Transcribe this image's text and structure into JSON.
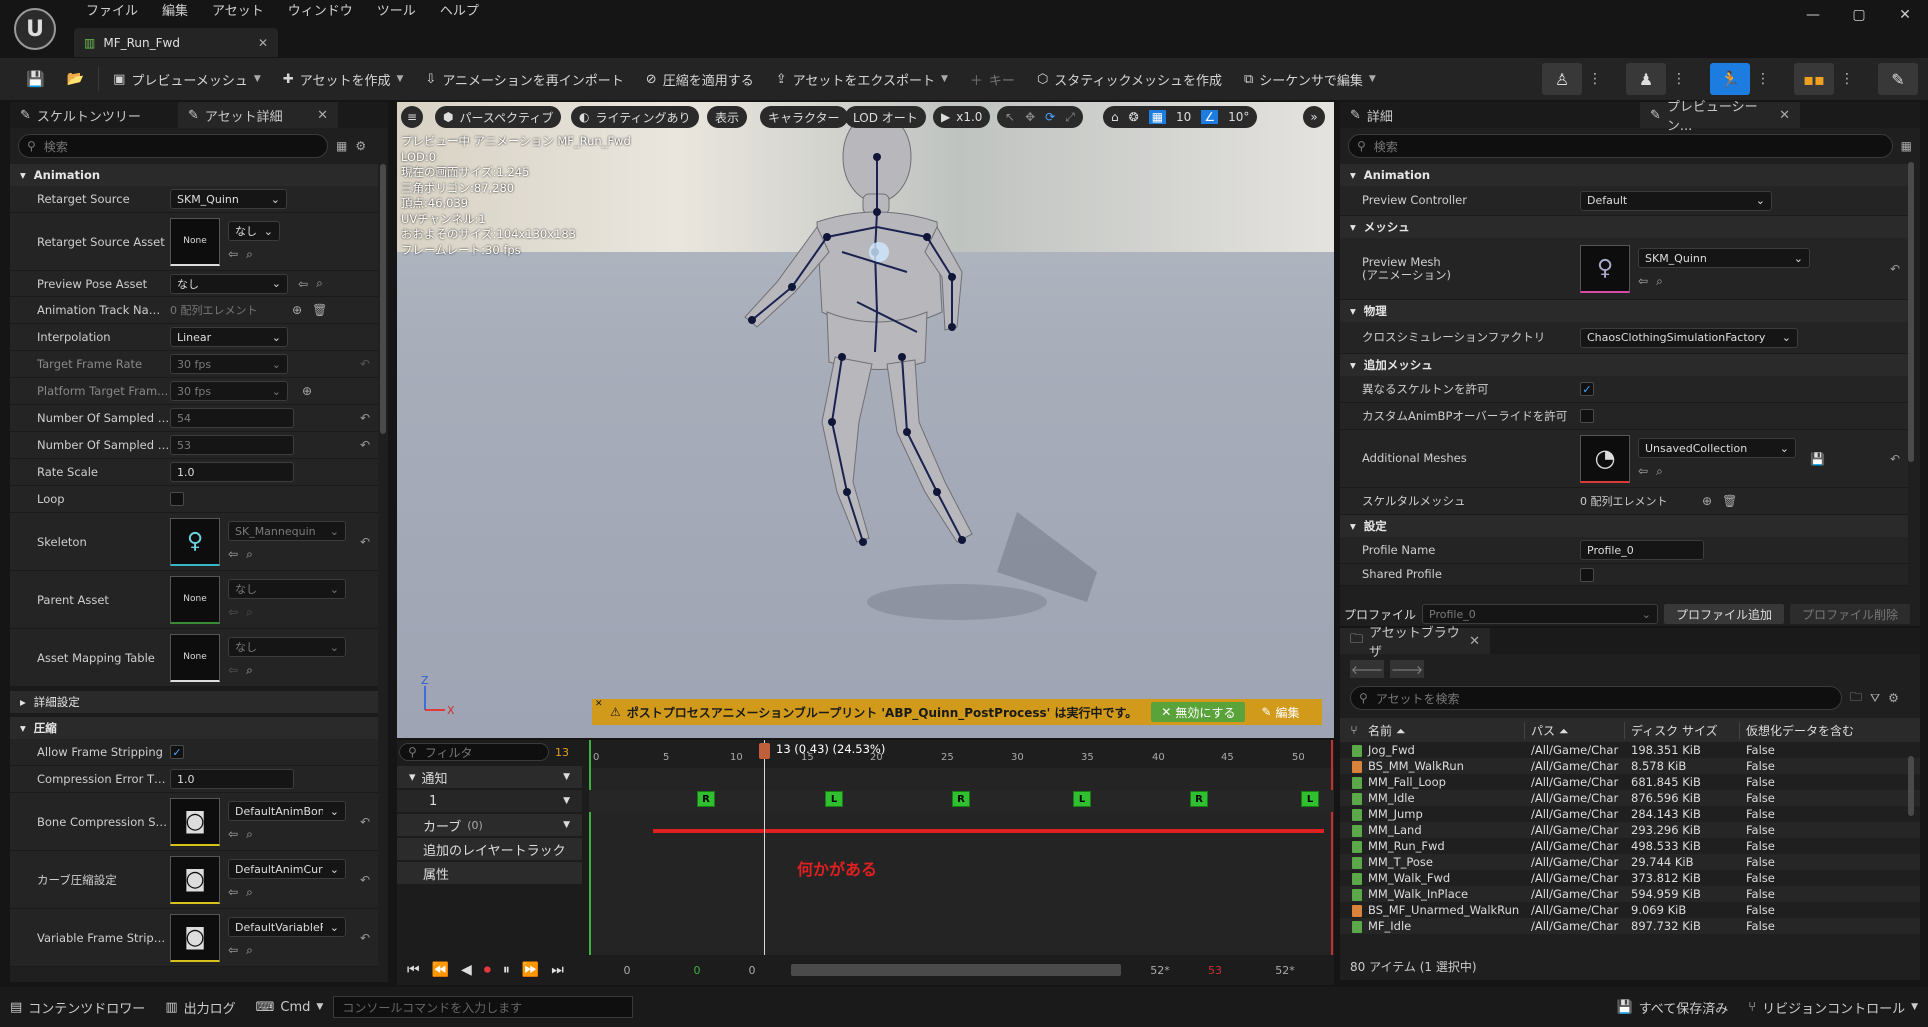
{
  "app": {
    "menu": [
      "ファイル",
      "編集",
      "アセット",
      "ウィンドウ",
      "ツール",
      "ヘルプ"
    ],
    "doc_tab": "MF_Run_Fwd",
    "logo_glyph": "U",
    "win_controls": [
      "—",
      "▢",
      "✕"
    ]
  },
  "toolbar": {
    "preview_mesh": "プレビューメッシュ",
    "create_asset": "アセットを作成",
    "reimport": "アニメーションを再インポート",
    "apply_compression": "圧縮を適用する",
    "export_asset": "アセットをエクスポート",
    "key": "キー",
    "create_static_mesh": "スタティックメッシュを作成",
    "edit_in_sequencer": "シーケンサで編集"
  },
  "left_panel": {
    "tab_skeleton_tree": "スケルトンツリー",
    "tab_asset_details": "アセット詳細",
    "search_placeholder": "検索",
    "section_animation": "Animation",
    "rows": {
      "retarget_source": {
        "label": "Retarget Source",
        "value": "SKM_Quinn"
      },
      "retarget_source_asset": {
        "label": "Retarget Source Asset",
        "thumb": "None",
        "value": "なし"
      },
      "preview_pose_asset": {
        "label": "Preview Pose Asset",
        "value": "なし"
      },
      "animation_track_names": {
        "label": "Animation Track Nam...",
        "value": "0 配列エレメント"
      },
      "interpolation": {
        "label": "Interpolation",
        "value": "Linear"
      },
      "target_frame_rate": {
        "label": "Target Frame Rate",
        "value": "30 fps"
      },
      "platform_target_frame": {
        "label": "Platform Target Fram...",
        "value": "30 fps"
      },
      "num_sampled_keys": {
        "label": "Number Of Sampled K...",
        "value": "54"
      },
      "num_sampled_frames": {
        "label": "Number Of Sampled F...",
        "value": "53"
      },
      "rate_scale": {
        "label": "Rate Scale",
        "value": "1.0"
      },
      "loop": {
        "label": "Loop"
      },
      "skeleton": {
        "label": "Skeleton",
        "value": "SK_Mannequin"
      },
      "parent_asset": {
        "label": "Parent Asset",
        "thumb": "None",
        "value": "なし"
      },
      "asset_mapping_table": {
        "label": "Asset Mapping Table",
        "thumb": "None",
        "value": "なし"
      }
    },
    "section_advanced": "詳細設定",
    "section_compression": "圧縮",
    "compression_rows": {
      "allow_frame_stripping": {
        "label": "Allow Frame Stripping"
      },
      "compression_error": {
        "label": "Compression Error Thr...",
        "value": "1.0"
      },
      "bone_compression": {
        "label": "Bone Compression Se...",
        "value": "DefaultAnimBone"
      },
      "curve_compression": {
        "label": "カーブ圧縮設定",
        "value": "DefaultAnimCurv"
      },
      "variable_frame": {
        "label": "Variable Frame Strippi...",
        "value": "DefaultVariableF"
      }
    }
  },
  "viewport": {
    "perspective": "パースペクティブ",
    "lighting": "ライティングあり",
    "show": "表示",
    "character": "キャラクター",
    "lod": "LOD オート",
    "play_rate": "x1.0",
    "grid_num": "10",
    "angle_num": "10°",
    "info": [
      "プレビュー中 アニメーション MF_Run_Fwd",
      "LOD:0",
      "現在の画面サイズ:1.245",
      "三角ポリゴン:87,280",
      "頂点:46,039",
      "UVチャンネル:1",
      "おおよそのサイズ:104x130x183",
      "フレームレート:30 fps"
    ],
    "axis_z": "Z",
    "axis_x": "X",
    "warning": "ポストプロセスアニメーションブループリント 'ABP_Quinn_PostProcess' は実行中です。",
    "disable_btn": "無効にする",
    "edit_btn": "編集"
  },
  "timeline": {
    "filter_placeholder": "フィルタ",
    "frame_count": "13",
    "current_frame": "13 (0.43) (24.53%)",
    "ticks": [
      "0",
      "5",
      "10",
      "15",
      "20",
      "25",
      "30",
      "35",
      "40",
      "45",
      "50"
    ],
    "tracks": {
      "notify": "通知",
      "notify_1": "1",
      "curves": "カーブ",
      "curves_count": "(0)",
      "additive": "追加のレイヤートラック",
      "attributes": "属性"
    },
    "notify_marks": [
      "R",
      "L",
      "R",
      "L",
      "R",
      "L"
    ],
    "annotation": "何かがある",
    "ctl_values": [
      "0",
      "0",
      "0",
      "52*",
      "53",
      "52*"
    ]
  },
  "details": {
    "tab_details": "詳細",
    "tab_preview": "プレビューシーン...",
    "search_placeholder": "検索",
    "section_animation": "Animation",
    "preview_controller": {
      "label": "Preview Controller",
      "value": "Default"
    },
    "section_mesh": "メッシュ",
    "preview_mesh": {
      "label": "Preview Mesh\n(アニメーション)",
      "value": "SKM_Quinn"
    },
    "section_physics": "物理",
    "cloth_factory": {
      "label": "クロスシミュレーションファクトリ",
      "value": "ChaosClothingSimulationFactory"
    },
    "section_additional": "追加メッシュ",
    "allow_diff_skeleton": {
      "label": "異なるスケルトンを許可"
    },
    "allow_custom_animbp": {
      "label": "カスタムAnimBPオーバーライドを許可"
    },
    "additional_meshes": {
      "label": "Additional Meshes",
      "value": "UnsavedCollection"
    },
    "skeletal_mesh": {
      "label": "スケルタルメッシュ",
      "value": "0 配列エレメント"
    },
    "section_settings": "設定",
    "profile_name": {
      "label": "Profile Name",
      "value": "Profile_0"
    },
    "shared_profile": {
      "label": "Shared Profile"
    },
    "profile_label": "プロファイル",
    "profile_value": "Profile_0",
    "add_profile": "プロファイル追加",
    "remove_profile": "プロファイル削除"
  },
  "asset_browser": {
    "title": "アセットブラウザ",
    "search_placeholder": "アセットを検索",
    "col_name": "名前",
    "col_path": "パス",
    "col_size": "ディスク サイズ",
    "col_virtual": "仮想化データを含む",
    "rows": [
      {
        "name": "Jog_Fwd",
        "path": "/All/Game/Char",
        "size": "198.351 KiB",
        "virtual": "False",
        "color": "#5aa84a"
      },
      {
        "name": "BS_MM_WalkRun",
        "path": "/All/Game/Char",
        "size": "8.578 KiB",
        "virtual": "False",
        "color": "#d9823a"
      },
      {
        "name": "MM_Fall_Loop",
        "path": "/All/Game/Char",
        "size": "681.845 KiB",
        "virtual": "False",
        "color": "#5aa84a"
      },
      {
        "name": "MM_Idle",
        "path": "/All/Game/Char",
        "size": "876.596 KiB",
        "virtual": "False",
        "color": "#5aa84a"
      },
      {
        "name": "MM_Jump",
        "path": "/All/Game/Char",
        "size": "284.143 KiB",
        "virtual": "False",
        "color": "#5aa84a"
      },
      {
        "name": "MM_Land",
        "path": "/All/Game/Char",
        "size": "293.296 KiB",
        "virtual": "False",
        "color": "#5aa84a"
      },
      {
        "name": "MM_Run_Fwd",
        "path": "/All/Game/Char",
        "size": "498.533 KiB",
        "virtual": "False",
        "color": "#5aa84a"
      },
      {
        "name": "MM_T_Pose",
        "path": "/All/Game/Char",
        "size": "29.744 KiB",
        "virtual": "False",
        "color": "#5aa84a"
      },
      {
        "name": "MM_Walk_Fwd",
        "path": "/All/Game/Char",
        "size": "373.812 KiB",
        "virtual": "False",
        "color": "#5aa84a"
      },
      {
        "name": "MM_Walk_InPlace",
        "path": "/All/Game/Char",
        "size": "594.959 KiB",
        "virtual": "False",
        "color": "#5aa84a"
      },
      {
        "name": "BS_MF_Unarmed_WalkRun",
        "path": "/All/Game/Char",
        "size": "9.069 KiB",
        "virtual": "False",
        "color": "#d9823a"
      },
      {
        "name": "MF_Idle",
        "path": "/All/Game/Char",
        "size": "897.732 KiB",
        "virtual": "False",
        "color": "#5aa84a"
      }
    ],
    "footer": "80 アイテム (1 選択中)"
  },
  "status": {
    "content_drawer": "コンテンツドロワー",
    "output_log": "出力ログ",
    "cmd": "Cmd",
    "console_placeholder": "コンソールコマンドを入力します",
    "save_all": "すべて保存済み",
    "revision_control": "リビジョンコントロール"
  }
}
